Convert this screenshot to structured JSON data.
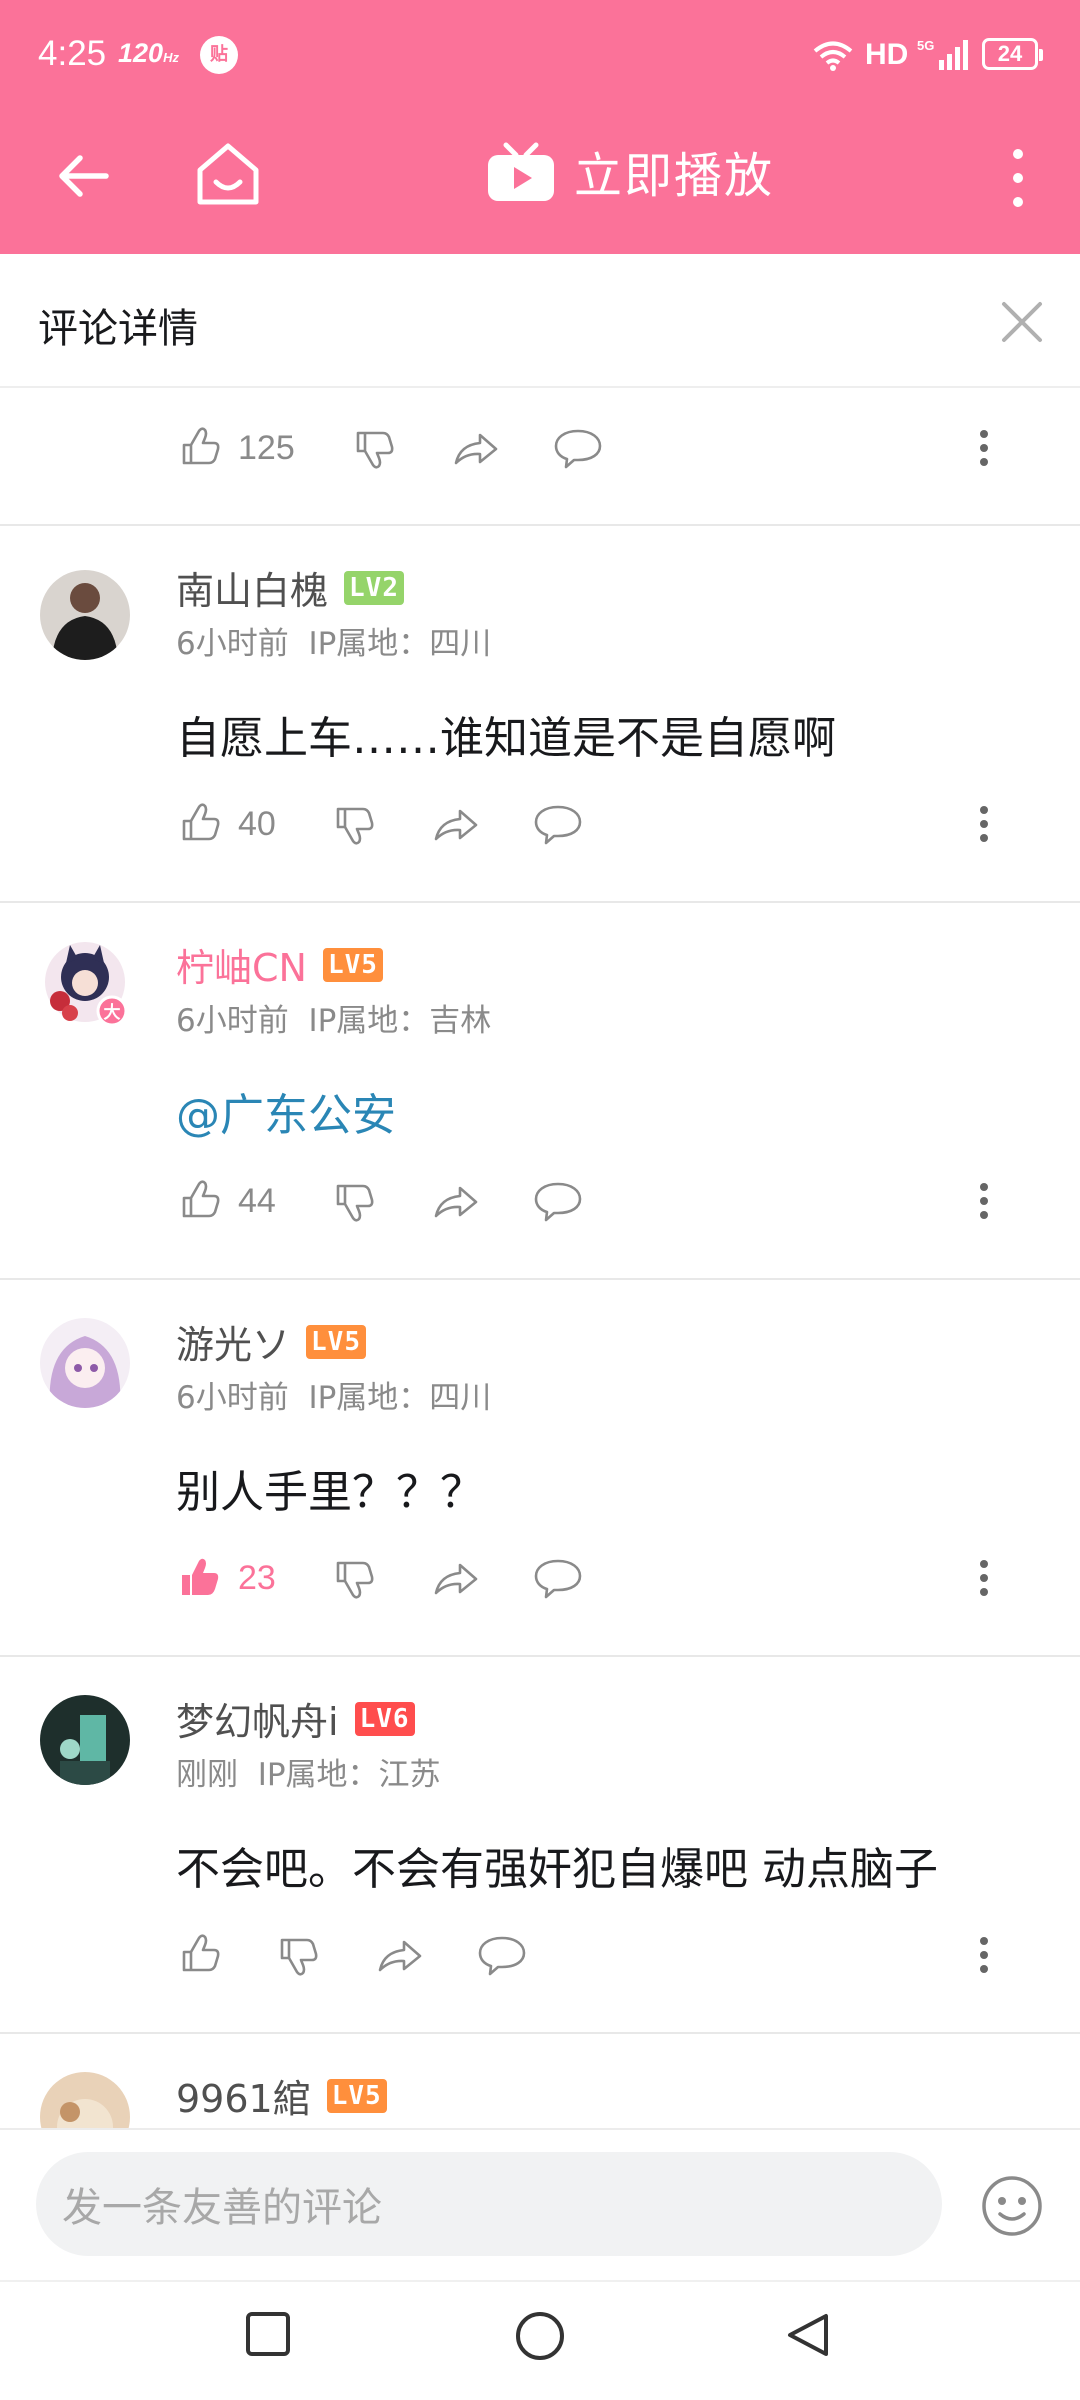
{
  "status_bar": {
    "time": "4:25",
    "refresh": "120",
    "refresh_unit": "Hz",
    "tie_icon_text": "贴",
    "network": "HD",
    "signal": "5G",
    "battery": "24"
  },
  "top_bar": {
    "play_label": "立即播放"
  },
  "detail": {
    "title": "评论详情"
  },
  "comments": [
    {
      "likes": "125"
    },
    {
      "username": "南山白槐",
      "level": "LV2",
      "time": "6小时前",
      "ip": "IP属地：四川",
      "text": "自愿上车……谁知道是不是自愿啊",
      "likes": "40"
    },
    {
      "username": "柠岫CN",
      "level": "LV5",
      "time": "6小时前",
      "ip": "IP属地：吉林",
      "text": "@广东公安",
      "likes": "44",
      "avatar_badge": "大"
    },
    {
      "username": "游光ソ",
      "level": "LV5",
      "time": "6小时前",
      "ip": "IP属地：四川",
      "text": "别人手里？？？",
      "likes": "23"
    },
    {
      "username": "梦幻帆舟i",
      "level": "LV6",
      "time": "刚刚",
      "ip": "IP属地：江苏",
      "text": "不会吧。不会有强奸犯自爆吧 动点脑子",
      "likes": ""
    },
    {
      "username": "9961綰",
      "level": "LV5"
    }
  ],
  "input": {
    "placeholder": "发一条友善的评论"
  },
  "colors": {
    "brand_pink": "#fb7299",
    "lv2": "#95d46a",
    "lv5": "#ff8f3c",
    "lv6": "#ff4d4d",
    "mention_blue": "#2a86b5"
  }
}
